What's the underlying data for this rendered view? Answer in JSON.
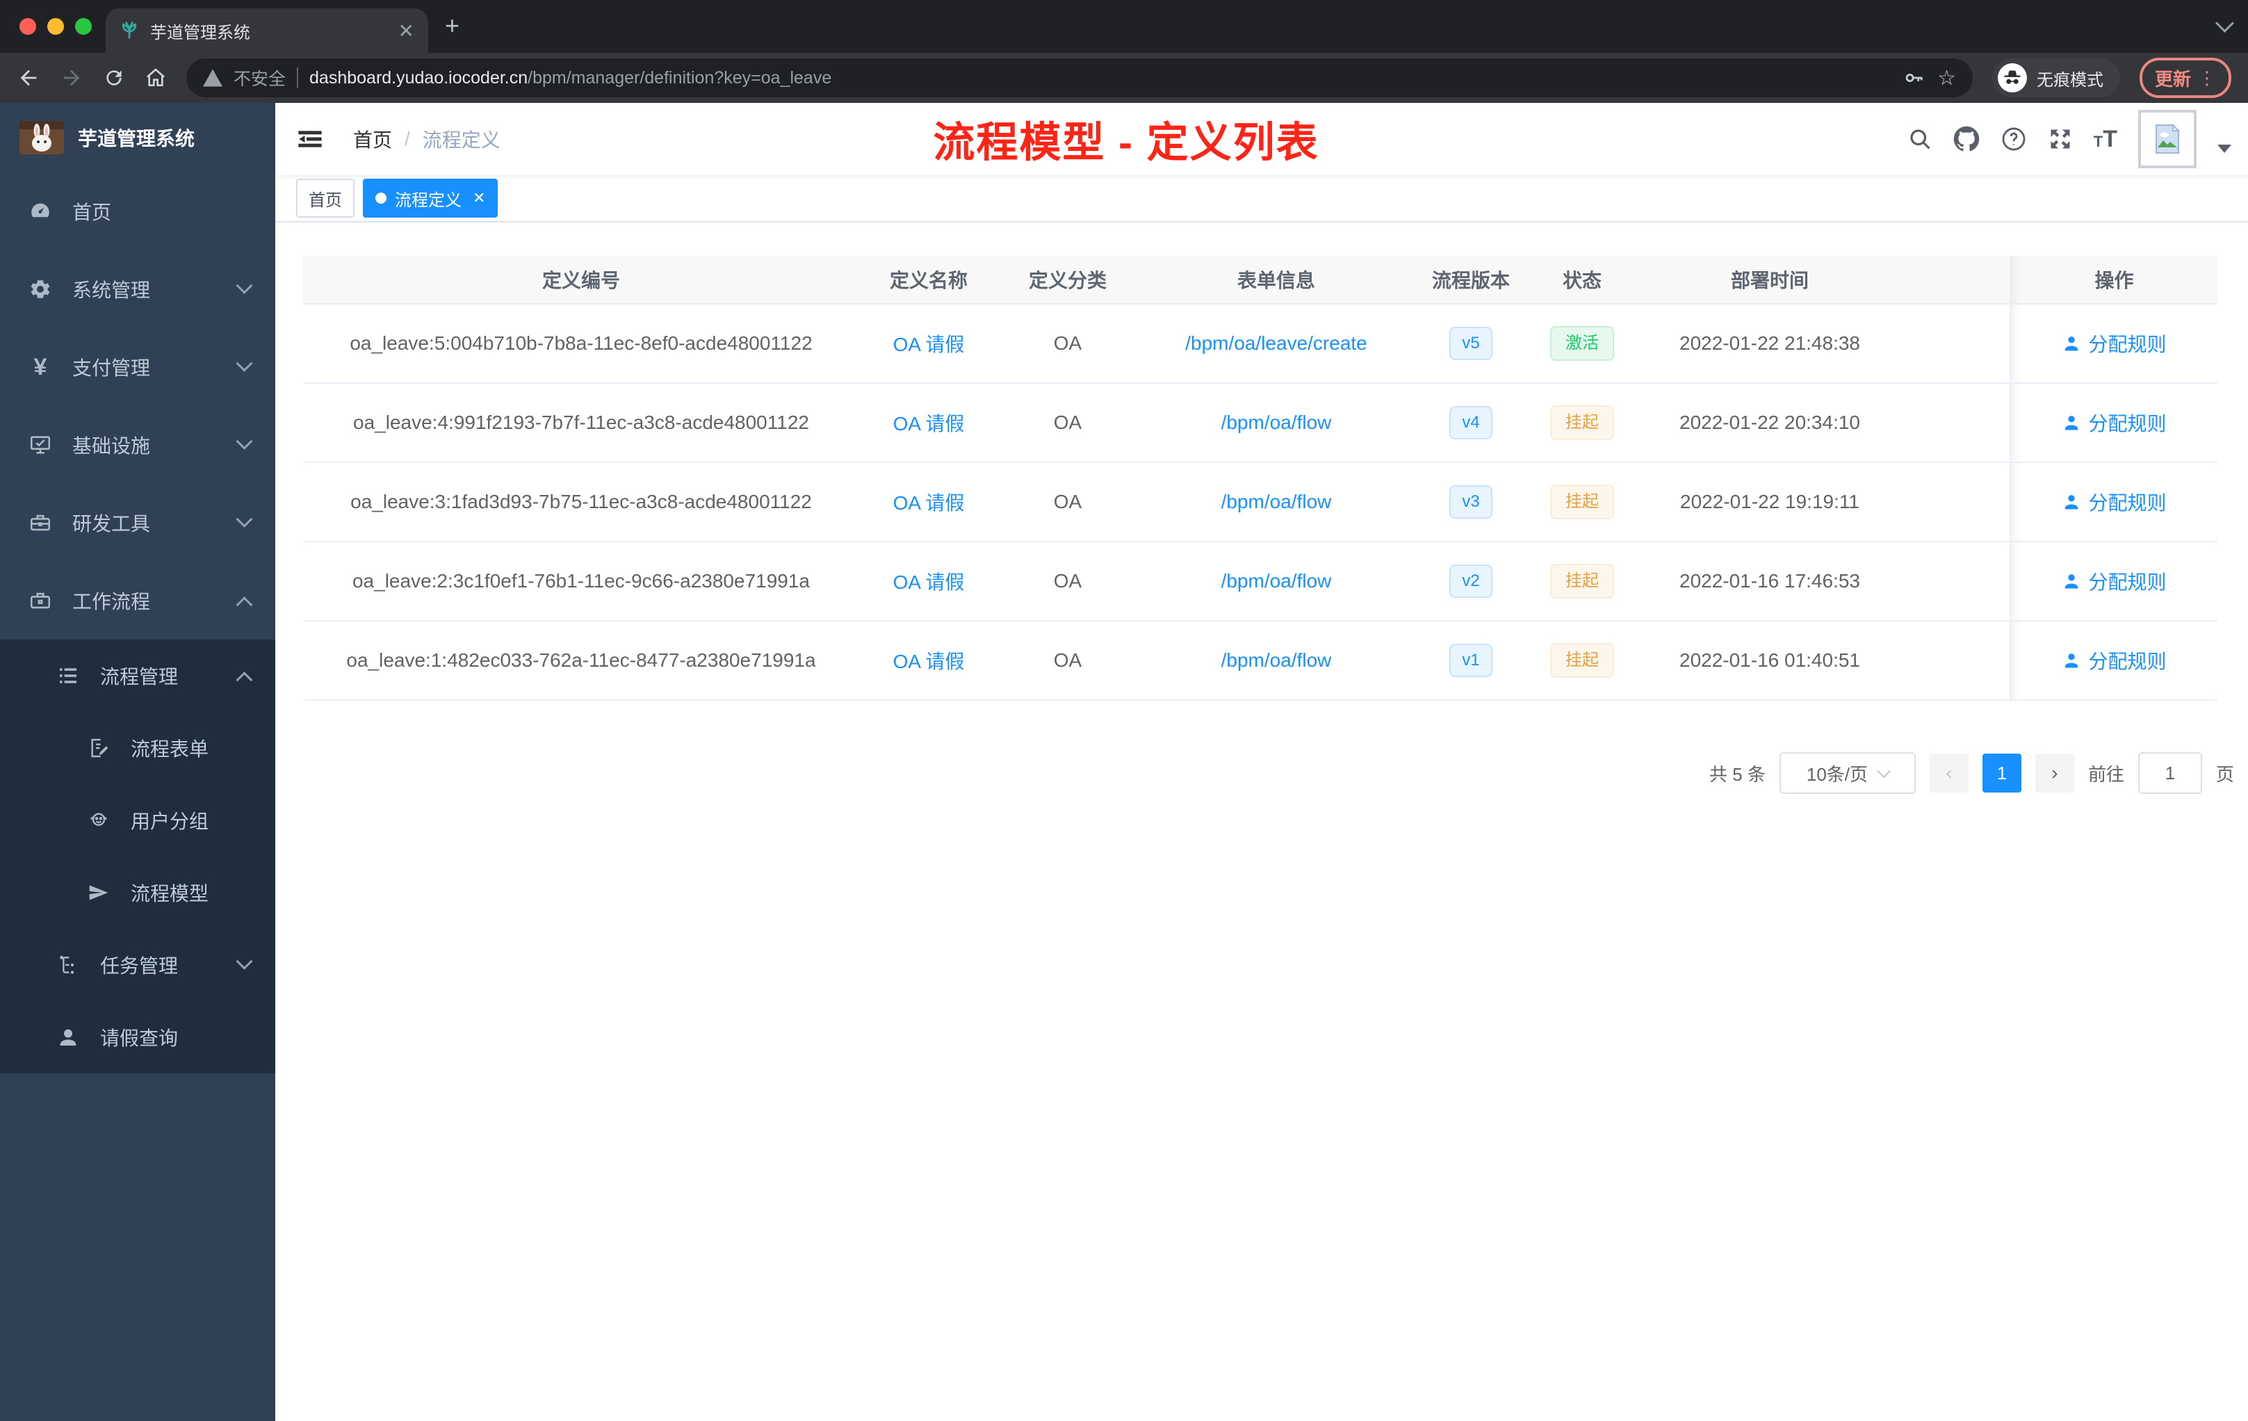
{
  "browser": {
    "tab_title": "芋道管理系统",
    "security_label": "不安全",
    "url_domain": "dashboard.yudao.iocoder.cn",
    "url_path": "/bpm/manager/definition?key=oa_leave",
    "incognito_label": "无痕模式",
    "update_label": "更新"
  },
  "sidebar": {
    "title": "芋道管理系统",
    "home": "首页",
    "system": "系统管理",
    "pay": "支付管理",
    "infra": "基础设施",
    "dev": "研发工具",
    "workflow": "工作流程",
    "process_manage": "流程管理",
    "process_form": "流程表单",
    "user_group": "用户分组",
    "process_model": "流程模型",
    "task_manage": "任务管理",
    "leave_query": "请假查询"
  },
  "header": {
    "breadcrumb_home": "首页",
    "breadcrumb_sep": "/",
    "breadcrumb_current": "流程定义",
    "annotation": "流程模型 - 定义列表"
  },
  "tags": {
    "home": "首页",
    "active": "流程定义"
  },
  "table": {
    "columns": {
      "id": "定义编号",
      "name": "定义名称",
      "category": "定义分类",
      "form": "表单信息",
      "version": "流程版本",
      "status": "状态",
      "deploy_time": "部署时间",
      "actions": "操作"
    },
    "rows": [
      {
        "id": "oa_leave:5:004b710b-7b8a-11ec-8ef0-acde48001122",
        "name": "OA 请假",
        "category": "OA",
        "form": "/bpm/oa/leave/create",
        "version": "v5",
        "status": "激活",
        "status_type": "success",
        "time": "2022-01-22 21:48:38",
        "action": "分配规则"
      },
      {
        "id": "oa_leave:4:991f2193-7b7f-11ec-a3c8-acde48001122",
        "name": "OA 请假",
        "category": "OA",
        "form": "/bpm/oa/flow",
        "version": "v4",
        "status": "挂起",
        "status_type": "warning",
        "time": "2022-01-22 20:34:10",
        "action": "分配规则"
      },
      {
        "id": "oa_leave:3:1fad3d93-7b75-11ec-a3c8-acde48001122",
        "name": "OA 请假",
        "category": "OA",
        "form": "/bpm/oa/flow",
        "version": "v3",
        "status": "挂起",
        "status_type": "warning",
        "time": "2022-01-22 19:19:11",
        "action": "分配规则"
      },
      {
        "id": "oa_leave:2:3c1f0ef1-76b1-11ec-9c66-a2380e71991a",
        "name": "OA 请假",
        "category": "OA",
        "form": "/bpm/oa/flow",
        "version": "v2",
        "status": "挂起",
        "status_type": "warning",
        "time": "2022-01-16 17:46:53",
        "action": "分配规则"
      },
      {
        "id": "oa_leave:1:482ec033-762a-11ec-8477-a2380e71991a",
        "name": "OA 请假",
        "category": "OA",
        "form": "/bpm/oa/flow",
        "version": "v1",
        "status": "挂起",
        "status_type": "warning",
        "time": "2022-01-16 01:40:51",
        "action": "分配规则"
      }
    ]
  },
  "pagination": {
    "total": "共 5 条",
    "page_size": "10条/页",
    "prev": "‹",
    "page": "1",
    "next": "›",
    "goto_label": "前往",
    "goto_value": "1",
    "unit_label": "页"
  },
  "colors": {
    "accent": "#1890ff",
    "annotation": "#ff2415",
    "status_active": "#13ce66",
    "status_suspend": "#e6a23c",
    "sidebar_bg": "#304156",
    "submenu_bg": "#1f2d3d"
  }
}
